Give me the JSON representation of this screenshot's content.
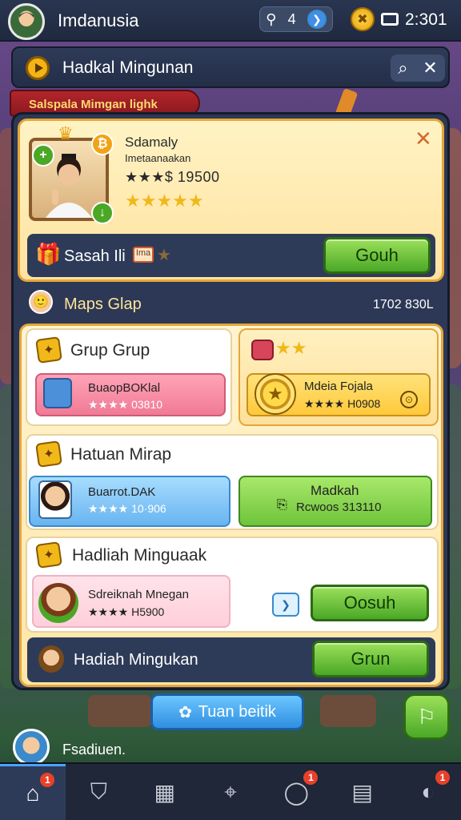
{
  "topbar": {
    "app_name": "Imdanusia",
    "resource_value": "4",
    "clock": "2:301"
  },
  "search": {
    "title": "Hadkal Mingunan"
  },
  "banner": {
    "text": "Salspala Mimgan lighk"
  },
  "featured": {
    "name_line1": "Sdamaly",
    "name_line2": "Imetaanaakan",
    "rating_text": "★★★$ 19500",
    "stars": "★★★★★",
    "bottom_label": "Sasah Ili",
    "tag_text": "Ima",
    "action_label": "Gouh"
  },
  "group": {
    "title": "Maps Glap",
    "count": "1702 830L"
  },
  "sections": {
    "grup": {
      "title": "Grup Grup",
      "item1_line1": "BuaopBOKlal",
      "item1_line2": "★★★★ 03810"
    },
    "mode": {
      "stars": "★★",
      "item_line1": "Mdeia Fojala",
      "item_line2": "★★★★ H0908"
    },
    "hatuan": {
      "title": "Hatuan Mirap",
      "item1_line1": "Buarrot.DAK",
      "item1_line2": "★★★★ 10·906",
      "item2_line1": "Madkah",
      "item2_line2": "Rcwoos 313110"
    },
    "hadiah": {
      "title": "Hadliah Minguaak",
      "item1_line1": "Sdreiknah Mnegan",
      "item1_line2": "★★★★ H5900",
      "action_label": "Oosuh"
    }
  },
  "bottom_strip": {
    "label": "Hadiah Mingukan",
    "action_label": "Grun"
  },
  "pill_button": {
    "label": "Tuan beitik"
  },
  "user": {
    "label": "Fsadiuen."
  },
  "nav": {
    "badges": [
      "1",
      "1",
      "1"
    ]
  },
  "colors": {
    "accent_green": "#4aa826",
    "panel_dark": "#2c3855",
    "gold": "#f1b81a",
    "banner_red": "#b3262a"
  },
  "icons": [
    "play-icon",
    "search-icon",
    "close-icon",
    "coin-icon",
    "cash-icon",
    "home-icon",
    "shop-icon",
    "inventory-icon",
    "map-icon",
    "chat-icon",
    "notes-icon",
    "message-icon"
  ]
}
